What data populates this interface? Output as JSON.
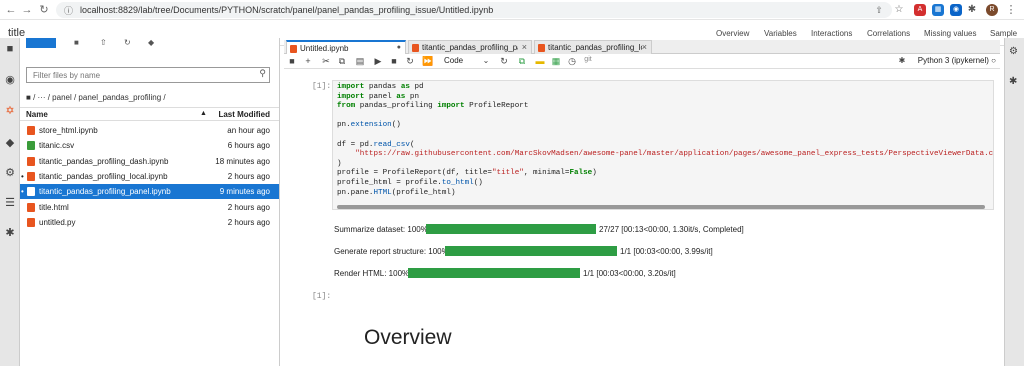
{
  "browser": {
    "url": "localhost:8829/lab/tree/Documents/PYTHON/scratch/panel/panel_pandas_profiling_issue/Untitled.ipynb",
    "profile_initial": "R"
  },
  "app": {
    "title": "title",
    "top_links": [
      "Overview",
      "Variables",
      "Interactions",
      "Correlations",
      "Missing values",
      "Sample"
    ]
  },
  "filebrowser": {
    "filter_placeholder": "Filter files by name",
    "breadcrumb": "/ ··· / panel / panel_pandas_profiling /",
    "col_name": "Name",
    "col_modified": "Last Modified",
    "files": [
      {
        "name": "store_html.ipynb",
        "modified": "an hour ago",
        "type": "notebook",
        "running": false,
        "selected": false
      },
      {
        "name": "titanic.csv",
        "modified": "6 hours ago",
        "type": "csv",
        "running": false,
        "selected": false
      },
      {
        "name": "titantic_pandas_profiling_dash.ipynb",
        "modified": "18 minutes ago",
        "type": "notebook",
        "running": false,
        "selected": false
      },
      {
        "name": "titantic_pandas_profiling_local.ipynb",
        "modified": "2 hours ago",
        "type": "notebook",
        "running": true,
        "selected": false
      },
      {
        "name": "titantic_pandas_profiling_panel.ipynb",
        "modified": "9 minutes ago",
        "type": "notebook",
        "running": true,
        "selected": true
      },
      {
        "name": "title.html",
        "modified": "2 hours ago",
        "type": "html",
        "running": false,
        "selected": false
      },
      {
        "name": "untitled.py",
        "modified": "2 hours ago",
        "type": "python",
        "running": false,
        "selected": false
      }
    ]
  },
  "tabs": [
    {
      "label": "Untitled.ipynb",
      "active": true
    },
    {
      "label": "titantic_pandas_profiling_pa",
      "active": false
    },
    {
      "label": "titantic_pandas_profiling_loc",
      "active": false
    }
  ],
  "toolbar": {
    "cell_type": "Code",
    "git_label": "git",
    "kernel": "Python 3 (ipykernel)"
  },
  "cells": {
    "prompt_1": "[1]:",
    "prompt_2": "[1]:",
    "code_lines": [
      "import pandas as pd",
      "import panel as pn",
      "from pandas_profiling import ProfileReport",
      "",
      "pn.extension()",
      "",
      "df = pd.read_csv(",
      "    \"https://raw.githubusercontent.com/MarcSkovMadsen/awesome-panel/master/application/pages/awesome_panel_express_tests/PerspectiveViewerData.csv\"",
      ")",
      "profile = ProfileReport(df, title=\"title\", minimal=False)",
      "profile_html = profile.to_html()",
      "pn.pane.HTML(profile_html)"
    ]
  },
  "progress": [
    {
      "label": "Summarize dataset: 100%",
      "fraction": 1.0,
      "text": "27/27 [00:13<00:00, 1.30it/s, Completed]"
    },
    {
      "label": "Generate report structure: 100%",
      "fraction": 1.0,
      "text": "1/1 [00:03<00:00, 3.99s/it]"
    },
    {
      "label": "Render HTML: 100%",
      "fraction": 1.0,
      "text": "1/1 [00:03<00:00, 3.20s/it]"
    }
  ],
  "report": {
    "overview_heading": "Overview"
  },
  "colors": {
    "accent": "#1976d2",
    "progress": "#2e9d44",
    "notebook_icon": "#e8551f",
    "csv_icon": "#3a9c3a"
  }
}
